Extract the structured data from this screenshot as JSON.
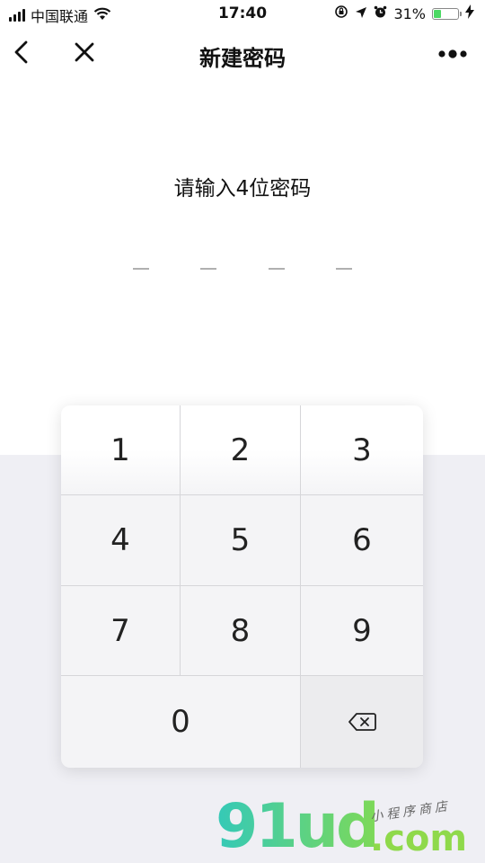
{
  "status_bar": {
    "carrier": "中国联通",
    "time": "17:40",
    "battery_percent": "31%",
    "battery_level": 0.31,
    "icons": [
      "signal-icon",
      "wifi-icon",
      "orientation-lock-icon",
      "location-icon",
      "alarm-icon",
      "battery-icon",
      "charging-icon"
    ]
  },
  "nav": {
    "title": "新建密码",
    "back_icon": "chevron-left-icon",
    "close_icon": "close-icon",
    "more_icon": "more-icon"
  },
  "prompt": "请输入4位密码",
  "pin": {
    "length": 4,
    "entered": 0
  },
  "keypad": {
    "keys": [
      "1",
      "2",
      "3",
      "4",
      "5",
      "6",
      "7",
      "8",
      "9",
      "0"
    ],
    "delete_icon": "backspace-icon"
  },
  "watermark": {
    "brand": "91ud",
    "suffix": ".com",
    "tagline": "小程序商店"
  },
  "colors": {
    "accent_battery": "#4cd964",
    "keypad_bg": "#f4f4f6",
    "lower_bg": "#efeff4"
  }
}
